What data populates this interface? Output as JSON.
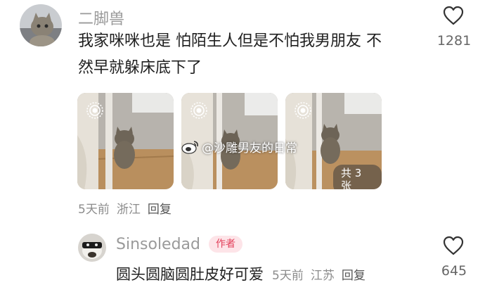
{
  "comment": {
    "username": "二脚兽",
    "text_line1": "我家咪咪也是 怕陌生人但是不怕我男朋友 不",
    "text_line2": "然早就躲床底下了",
    "like_count": "1281",
    "time": "5天前",
    "location": "浙江",
    "reply_label": "回复",
    "image_count_label": "共 3 张",
    "watermark_text": "@沙雕男友的日常"
  },
  "reply": {
    "username": "Sinsoledad",
    "author_badge": "作者",
    "text": "圆头圆脑圆肚皮好可爱",
    "time": "5天前",
    "location": "江苏",
    "reply_label": "回复",
    "like_count": "645"
  },
  "icons": {
    "like": "heart-outline-icon",
    "live_photo": "live-photo-icon",
    "weibo": "weibo-logo-icon"
  },
  "colors": {
    "author_badge_text": "#e2405a",
    "author_badge_bg": "#fde4e8",
    "meta_text": "#8c8c8c"
  }
}
